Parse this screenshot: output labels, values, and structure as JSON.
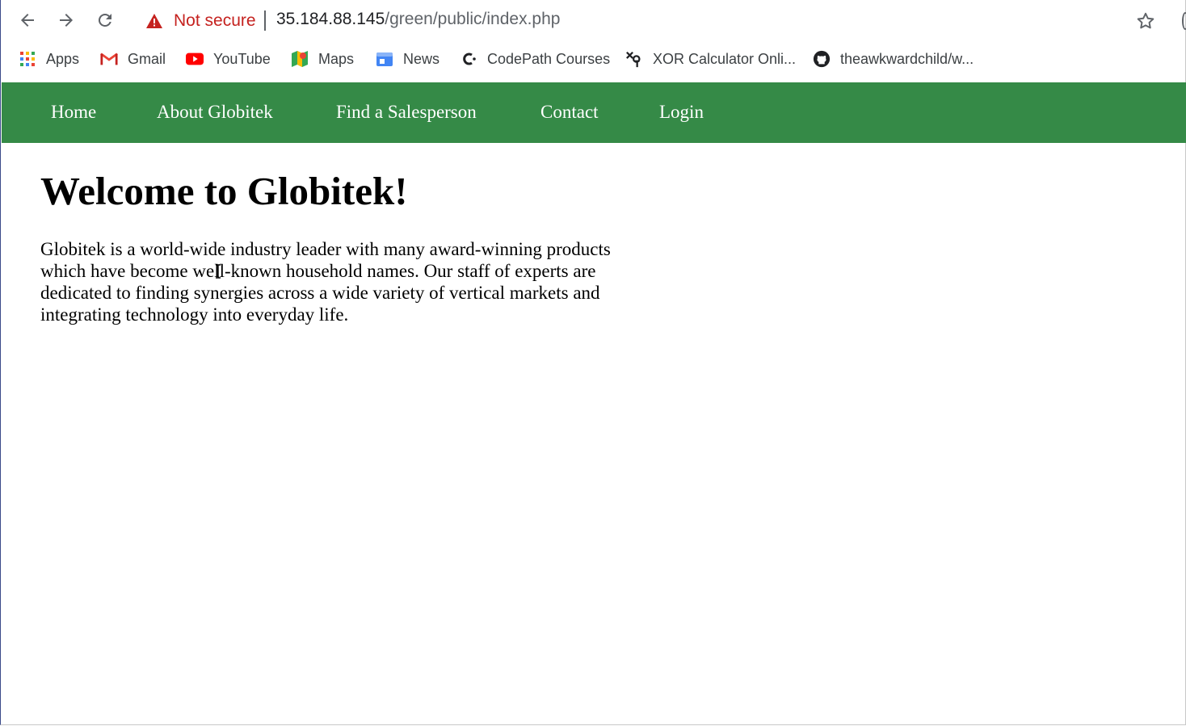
{
  "browser": {
    "security_label": "Not secure",
    "url_host": "35.184.88.145",
    "url_path": "/green/public/index.php",
    "warning_color": "#c5221f",
    "icons": [
      "back-icon",
      "forward-icon",
      "reload-icon",
      "warning-icon",
      "bookmark-star-icon"
    ]
  },
  "bookmarks": [
    {
      "label": "Apps",
      "icon": "apps-grid-icon"
    },
    {
      "label": "Gmail",
      "icon": "gmail-icon"
    },
    {
      "label": "YouTube",
      "icon": "youtube-icon"
    },
    {
      "label": "Maps",
      "icon": "maps-icon"
    },
    {
      "label": "News",
      "icon": "news-icon"
    },
    {
      "label": "CodePath Courses",
      "icon": "codepath-icon"
    },
    {
      "label": "XOR Calculator Onli...",
      "icon": "xor-icon"
    },
    {
      "label": "theawkwardchild/w...",
      "icon": "github-icon"
    }
  ],
  "site": {
    "nav_color": "#358a47",
    "nav": [
      "Home",
      "About Globitek",
      "Find a Salesperson",
      "Contact",
      "Login"
    ],
    "heading": "Welcome to Globitek!",
    "intro": "Globitek is a world-wide industry leader with many award-winning products which have become well-known household names. Our staff of experts are dedicated to finding synergies across a wide variety of vertical markets and integrating technology into everyday life."
  }
}
